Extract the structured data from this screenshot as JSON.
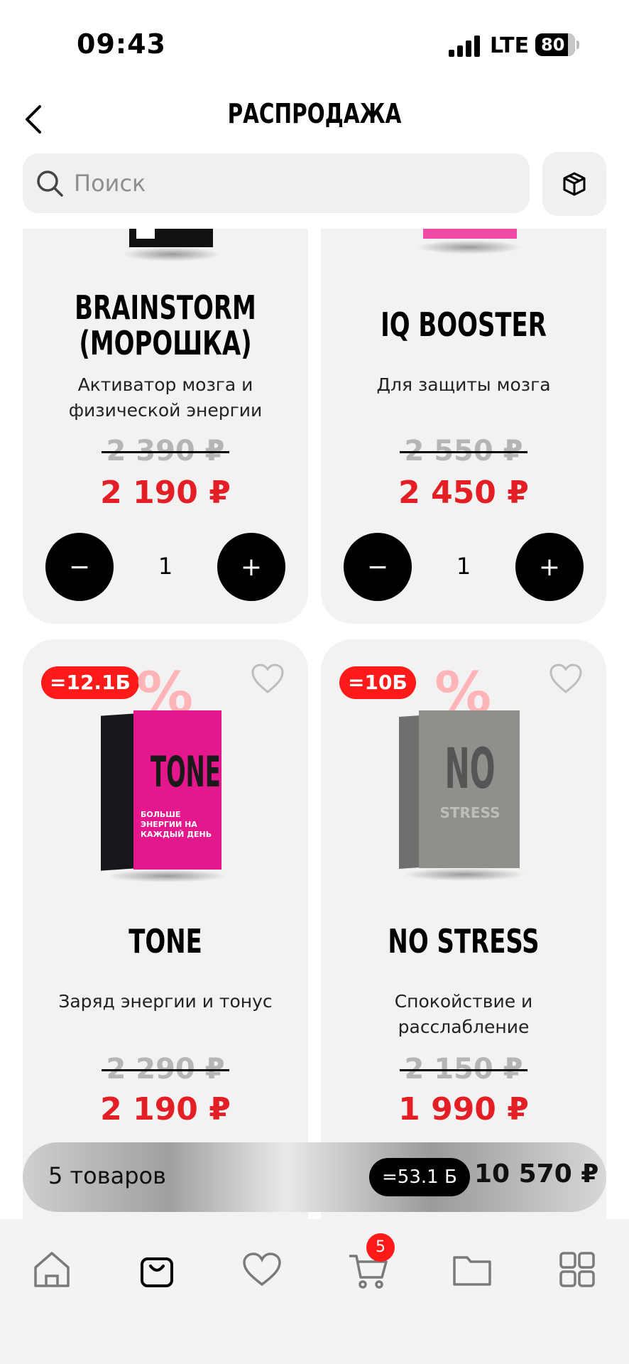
{
  "status": {
    "time": "09:43",
    "network": "LTE",
    "battery": "80"
  },
  "header": {
    "title": "РАСПРОДАЖА"
  },
  "search": {
    "placeholder": "Поиск"
  },
  "products": [
    {
      "name": "BRAINSTORM (МОРОШКА)",
      "description": "Активатор мозга и физической энергии",
      "old_price": "2 390 ₽",
      "price": "2 190 ₽",
      "quantity": "1"
    },
    {
      "name": "IQ BOOSTER",
      "description": "Для защиты мозга",
      "old_price": "2 550 ₽",
      "price": "2 450 ₽",
      "quantity": "1"
    },
    {
      "name": "TONE",
      "description": "Заряд энергии и тонус",
      "old_price": "2 290 ₽",
      "price": "2 190 ₽",
      "bonus": "=12.1Б",
      "box_label": "TONE",
      "box_sublabel": "БОЛЬШЕ ЭНЕРГИИ НА КАЖДЫЙ ДЕНЬ",
      "box_color": "#e5178c"
    },
    {
      "name": "NO STRESS",
      "description": "Спокойствие и расслабление",
      "old_price": "2 150 ₽",
      "price": "1 990 ₽",
      "bonus": "=10Б",
      "box_label": "NO",
      "box_sublabel": "STRESS",
      "box_color": "#8f8f8c"
    }
  ],
  "qty_controls": {
    "minus": "−",
    "plus": "+"
  },
  "percent_symbol": "%",
  "cart": {
    "count_label": "5 товаров",
    "bonus": "=53.1 Б",
    "total": "10 570 ₽",
    "badge": "5"
  },
  "colors": {
    "accent": "#e31e24",
    "badge_red": "#ff1a1a"
  },
  "tabbar": [
    "home-icon",
    "shopping-bag-icon",
    "heart-icon",
    "cart-icon",
    "folder-icon",
    "grid-icon"
  ]
}
